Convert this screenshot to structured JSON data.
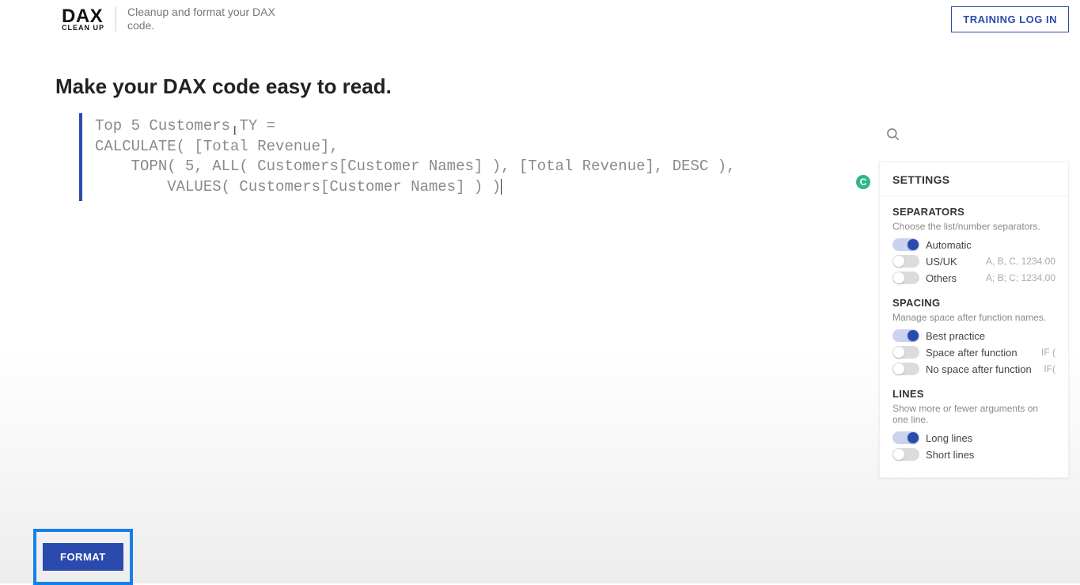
{
  "header": {
    "logo_main": "DAX",
    "logo_sub": "CLEAN UP",
    "tagline": "Cleanup and format your DAX code.",
    "login_label": "TRAINING LOG IN"
  },
  "page_title": "Make your DAX code easy to read.",
  "code": {
    "line1": "Top 5 Customers TY =",
    "line2": "CALCULATE( [Total Revenue],",
    "line3": "    TOPN( 5, ALL( Customers[Customer Names] ), [Total Revenue], DESC ),",
    "line4": "        VALUES( Customers[Customer Names] ) )"
  },
  "settings": {
    "title": "SETTINGS",
    "separators": {
      "title": "SEPARATORS",
      "desc": "Choose the list/number separators.",
      "automatic": "Automatic",
      "usuk": "US/UK",
      "usuk_hint": "A, B, C, 1234.00",
      "others": "Others",
      "others_hint": "A; B; C; 1234,00"
    },
    "spacing": {
      "title": "SPACING",
      "desc": "Manage space after function names.",
      "best": "Best practice",
      "space_after": "Space after function",
      "space_after_hint": "IF (",
      "no_space": "No space after function",
      "no_space_hint": "IF("
    },
    "lines": {
      "title": "LINES",
      "desc": "Show more or fewer arguments on one line.",
      "long": "Long lines",
      "short": "Short lines"
    }
  },
  "format_label": "FORMAT"
}
